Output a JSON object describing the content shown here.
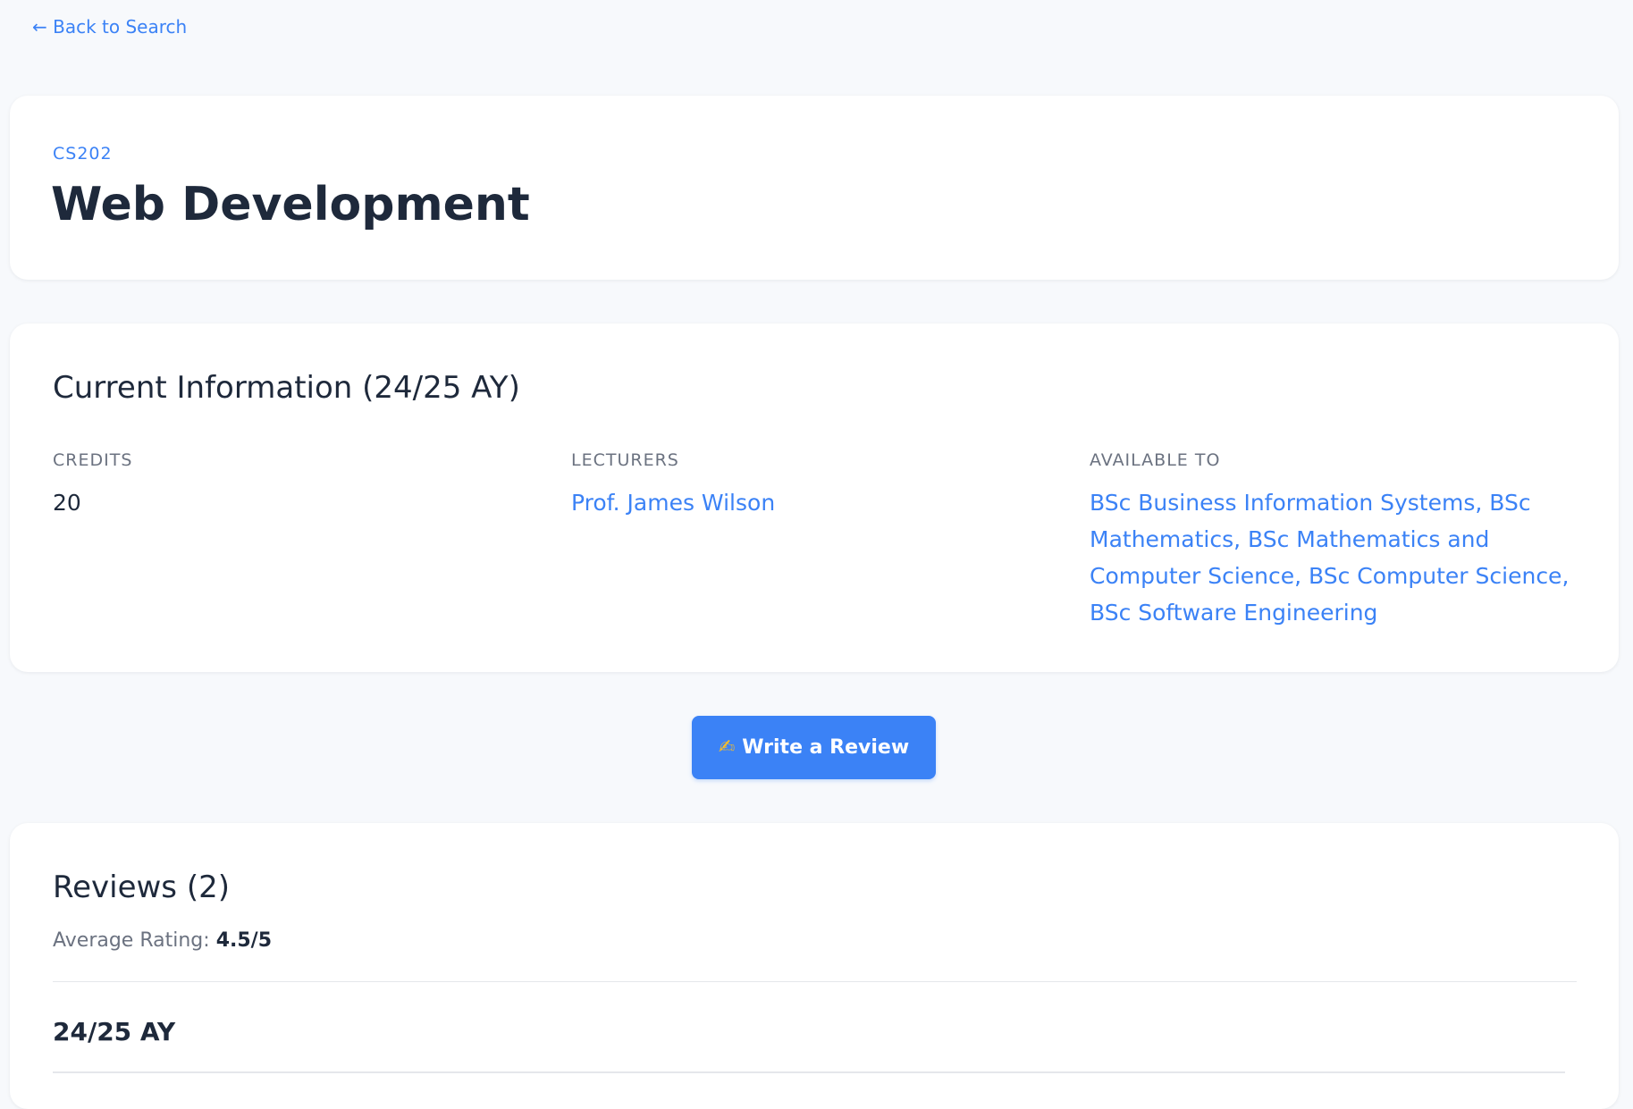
{
  "navigation": {
    "back_link": "← Back to Search"
  },
  "course": {
    "code": "CS202",
    "title": "Web Development"
  },
  "current_info": {
    "heading": "Current Information (24/25 AY)",
    "credits": {
      "label": "CREDITS",
      "value": "20"
    },
    "lecturers": {
      "label": "LECTURERS",
      "value": "Prof. James Wilson"
    },
    "available_to": {
      "label": "AVAILABLE TO",
      "value": "BSc Business Information Systems, BSc Mathematics, BSc Mathematics and Computer Science, BSc Computer Science, BSc Software Engineering"
    }
  },
  "actions": {
    "write_review_icon": "✍",
    "write_review_label": "Write a Review"
  },
  "reviews": {
    "heading": "Reviews (2)",
    "average_label": "Average Rating:",
    "average_value": "4.5/5",
    "year_group": "24/25 AY"
  },
  "colors": {
    "accent": "#3b82f6",
    "background": "#f7f9fc",
    "card": "#ffffff",
    "heading_text": "#1e293b",
    "muted_text": "#6b7280"
  }
}
